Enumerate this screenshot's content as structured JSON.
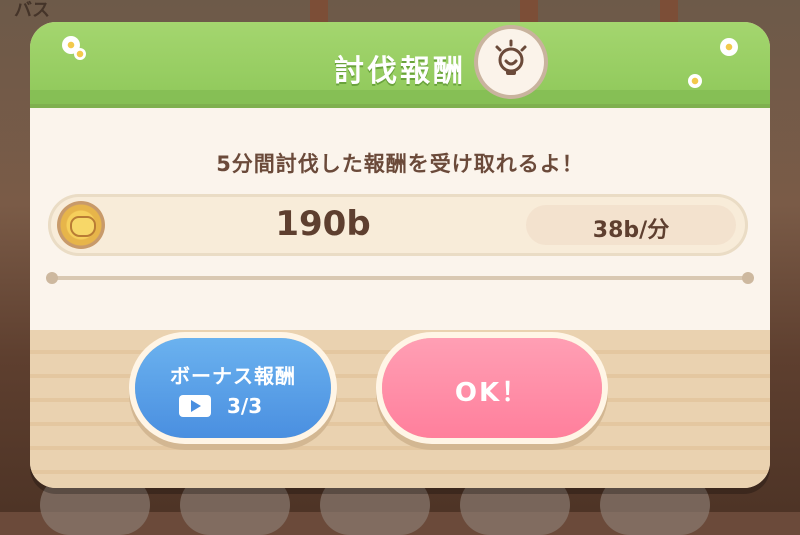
{
  "background": {
    "label": "バス"
  },
  "modal": {
    "title": "討伐報酬",
    "header_icon": "reward-lightbulb-icon",
    "message": "5分間討伐した報酬を受け取れるよ！",
    "reward": {
      "coin_icon": "coin-icon",
      "amount": "190b",
      "rate": "38b/分"
    },
    "buttons": {
      "bonus_label": "ボーナス報酬",
      "bonus_count": "3/3",
      "bonus_icon": "video-play-icon",
      "ok_label": "OK！"
    }
  },
  "colors": {
    "header_green": "#8fc85a",
    "bonus_blue": "#4a8fe0",
    "ok_pink": "#ff7f9c",
    "text_brown": "#5e3f2f"
  }
}
